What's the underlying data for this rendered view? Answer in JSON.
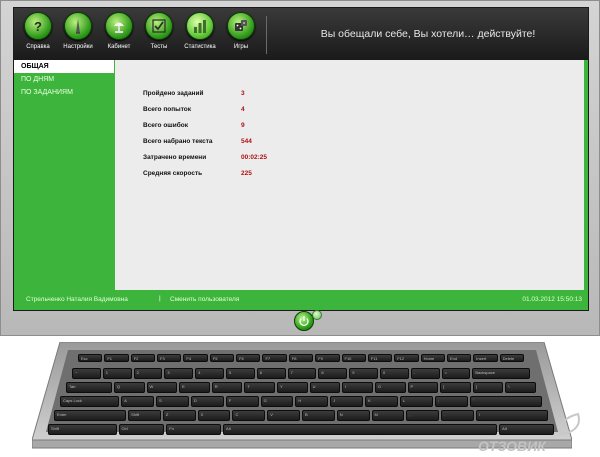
{
  "toolbar": {
    "items": [
      {
        "label": "Справка",
        "icon": "help-icon"
      },
      {
        "label": "Настройки",
        "icon": "settings-icon"
      },
      {
        "label": "Кабинет",
        "icon": "cabinet-lamp-icon"
      },
      {
        "label": "Тесты",
        "icon": "tests-checklist-icon"
      },
      {
        "label": "Статистика",
        "icon": "statistics-chart-icon"
      },
      {
        "label": "Игры",
        "icon": "games-dice-icon"
      }
    ],
    "tagline": "Вы обещали себе, Вы хотели… действуйте!"
  },
  "sidebar": {
    "items": [
      {
        "label": "ОБЩАЯ",
        "active": true
      },
      {
        "label": "ПО ДНЯМ",
        "active": false
      },
      {
        "label": "ПО ЗАДАНИЯМ",
        "active": false
      }
    ]
  },
  "stats": [
    {
      "label": "Пройдено заданий",
      "value": "3"
    },
    {
      "label": "Всего попыток",
      "value": "4"
    },
    {
      "label": "Всего ошибок",
      "value": "9"
    },
    {
      "label": "Всего набрано текста",
      "value": "544"
    },
    {
      "label": "Затрачено времени",
      "value": "00:02:25"
    },
    {
      "label": "Средняя скорость",
      "value": "225"
    }
  ],
  "status": {
    "user": "Стрельченко Наталия Вадимовна",
    "separator": "|",
    "change_user": "Сменить пользователя",
    "datetime": "01.03.2012 15:50:13"
  },
  "keyboard": {
    "keys": [
      "Esc",
      "F1",
      "F2",
      "F3",
      "F4",
      "F5",
      "F6",
      "F7",
      "F8",
      "F9",
      "F10",
      "F11",
      "F12",
      "Home",
      "End",
      "Insert",
      "Delete",
      "~",
      "1",
      "2",
      "3",
      "4",
      "5",
      "6",
      "7",
      "8",
      "9",
      "0",
      "-",
      "=",
      "Backspace",
      "Tab",
      "Q",
      "W",
      "E",
      "R",
      "T",
      "Y",
      "U",
      "I",
      "O",
      "P",
      "[",
      "]",
      "\\",
      "Caps Lock",
      "A",
      "S",
      "D",
      "F",
      "G",
      "H",
      "J",
      "K",
      "L",
      ";",
      "'",
      "Enter",
      "Shift",
      "Z",
      "X",
      "C",
      "V",
      "B",
      "N",
      "M",
      ",",
      ".",
      "/",
      "Shift",
      "Ctrl",
      "Fn",
      "Alt",
      "Alt",
      "Ctrl"
    ]
  },
  "watermark": "ОТЗОВИК"
}
